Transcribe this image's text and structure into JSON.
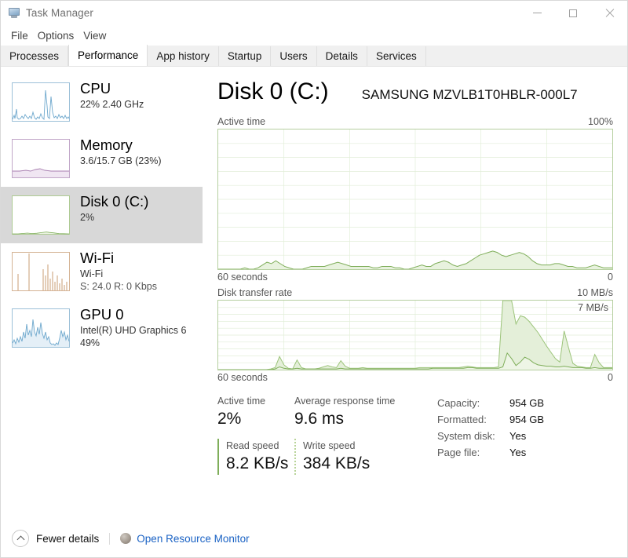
{
  "window": {
    "title": "Task Manager",
    "icon": "task-manager-icon",
    "controls": {
      "minimize": "–",
      "maximize": "□",
      "close": "✕"
    }
  },
  "menu": {
    "items": [
      "File",
      "Options",
      "View"
    ]
  },
  "tabs": {
    "items": [
      {
        "label": "Processes",
        "active": false
      },
      {
        "label": "Performance",
        "active": true
      },
      {
        "label": "App history",
        "active": false
      },
      {
        "label": "Startup",
        "active": false
      },
      {
        "label": "Users",
        "active": false
      },
      {
        "label": "Details",
        "active": false
      },
      {
        "label": "Services",
        "active": false
      }
    ]
  },
  "sidebar": {
    "items": [
      {
        "name": "cpu",
        "title": "CPU",
        "line1": "22%  2.40 GHz",
        "line2": "",
        "selected": false,
        "color": "#6ea8cd"
      },
      {
        "name": "memory",
        "title": "Memory",
        "line1": "3.6/15.7 GB (23%)",
        "line2": "",
        "selected": false,
        "color": "#a87fb0"
      },
      {
        "name": "disk",
        "title": "Disk 0 (C:)",
        "line1": "2%",
        "line2": "",
        "selected": true,
        "color": "#7fae5a"
      },
      {
        "name": "wifi",
        "title": "Wi-Fi",
        "line1": "Wi-Fi",
        "line2": "S: 24.0 R: 0 Kbps",
        "selected": false,
        "color": "#c39364"
      },
      {
        "name": "gpu",
        "title": "GPU 0",
        "line1": "Intel(R) UHD Graphics 6",
        "line2": "49%",
        "selected": false,
        "color": "#6ea8cd"
      }
    ]
  },
  "main": {
    "title": "Disk 0 (C:)",
    "model": "SAMSUNG MZVLB1T0HBLR-000L7"
  },
  "chart_data": [
    {
      "id": "active-time-chart",
      "type": "area",
      "title": "Active time",
      "ylabel_right": "100%",
      "xlabel_left": "60 seconds",
      "xlabel_right": "0",
      "ylim": [
        0,
        100
      ],
      "grid": true,
      "line_color": "#7fae5a",
      "fill_color": "#e8f2de",
      "values": [
        0,
        0,
        0,
        0,
        0,
        0,
        1,
        0,
        0,
        1,
        3,
        5,
        4,
        6,
        4,
        2,
        1,
        0,
        0,
        0,
        1,
        2,
        2,
        2,
        2,
        3,
        4,
        5,
        4,
        3,
        2,
        2,
        2,
        2,
        2,
        1,
        1,
        2,
        2,
        2,
        1,
        1,
        0,
        0,
        1,
        2,
        3,
        2,
        2,
        4,
        5,
        6,
        5,
        3,
        2,
        3,
        4,
        6,
        8,
        10,
        11,
        12,
        13,
        12,
        10,
        9,
        10,
        11,
        12,
        11,
        9,
        6,
        4,
        3,
        3,
        3,
        4,
        4,
        3,
        2,
        2,
        1,
        1,
        1,
        2,
        3,
        2,
        1,
        1,
        1
      ]
    },
    {
      "id": "disk-transfer-rate-chart",
      "type": "area",
      "title": "Disk transfer rate",
      "ylabel_right": "10 MB/s",
      "inline_label": "7 MB/s",
      "xlabel_left": "60 seconds",
      "xlabel_right": "0",
      "ylim": [
        0,
        10
      ],
      "grid": true,
      "series": [
        {
          "name": "write",
          "line_color": "#9cc47a",
          "fill_color": "#e4efd9",
          "values": [
            0,
            0,
            0,
            0,
            0,
            0,
            0,
            0,
            0,
            0,
            0,
            0,
            0.1,
            0.3,
            1.9,
            0.7,
            0.2,
            0.1,
            1.4,
            0.3,
            0.1,
            0.1,
            0.1,
            0.2,
            0.4,
            0.6,
            0.4,
            0.3,
            1.3,
            0.5,
            0.2,
            0.2,
            0.2,
            0.3,
            0.2,
            0.2,
            0.2,
            0.2,
            0.2,
            0.2,
            0.2,
            0.2,
            0.2,
            0.2,
            0.2,
            0.2,
            0.3,
            0.3,
            0.3,
            0.3,
            0.3,
            0.3,
            0.3,
            0.3,
            0.3,
            0.3,
            0.4,
            0.5,
            0.4,
            0.3,
            0.3,
            0.3,
            0.3,
            0.3,
            0.4,
            10,
            10,
            10,
            6.6,
            7.8,
            7.6,
            7.0,
            6.2,
            5.4,
            4.4,
            3.4,
            2.5,
            1.6,
            1.1,
            5.6,
            3.2,
            0.9,
            0.5,
            0.4,
            0.3,
            0.3,
            2.2,
            1.0,
            0.3,
            0.3,
            0.3
          ]
        },
        {
          "name": "read",
          "line_color": "#7fae5a",
          "fill_color": "#eef5e6",
          "values": [
            0,
            0,
            0,
            0,
            0,
            0,
            0,
            0,
            0,
            0,
            0,
            0,
            0,
            0.1,
            0.4,
            0.2,
            0.1,
            0.1,
            0.2,
            0.1,
            0.1,
            0.1,
            0.1,
            0.1,
            0.1,
            0.1,
            0.1,
            0.1,
            0.2,
            0.1,
            0.1,
            0.1,
            0.1,
            0.1,
            0.1,
            0.1,
            0.1,
            0.1,
            0.1,
            0.1,
            0.1,
            0.1,
            0.1,
            0.1,
            0.1,
            0.1,
            0.1,
            0.1,
            0.1,
            0.2,
            0.2,
            0.2,
            0.2,
            0.2,
            0.2,
            0.2,
            0.2,
            0.3,
            0.3,
            0.2,
            0.2,
            0.2,
            0.2,
            0.2,
            0.2,
            0.4,
            2.4,
            1.6,
            0.6,
            1.1,
            1.8,
            1.5,
            1.0,
            0.7,
            0.6,
            0.5,
            0.5,
            0.4,
            0.4,
            0.5,
            0.4,
            0.3,
            0.3,
            0.3,
            0.2,
            0.2,
            0.3,
            0.2,
            0.2,
            0.2,
            0.2
          ]
        }
      ]
    }
  ],
  "stats": {
    "active_time": {
      "label": "Active time",
      "value": "2%"
    },
    "avg_response": {
      "label": "Average response time",
      "value": "9.6 ms"
    },
    "read_speed": {
      "label": "Read speed",
      "value": "8.2 KB/s"
    },
    "write_speed": {
      "label": "Write speed",
      "value": "384 KB/s"
    },
    "info": [
      {
        "key": "Capacity:",
        "value": "954 GB"
      },
      {
        "key": "Formatted:",
        "value": "954 GB"
      },
      {
        "key": "System disk:",
        "value": "Yes"
      },
      {
        "key": "Page file:",
        "value": "Yes"
      }
    ]
  },
  "footer": {
    "fewer_details": "Fewer details",
    "resource_monitor": "Open Resource Monitor"
  },
  "colors": {
    "disk_accent": "#7fae5a",
    "link": "#1a62c4",
    "selected_row": "#d8d8d8"
  }
}
